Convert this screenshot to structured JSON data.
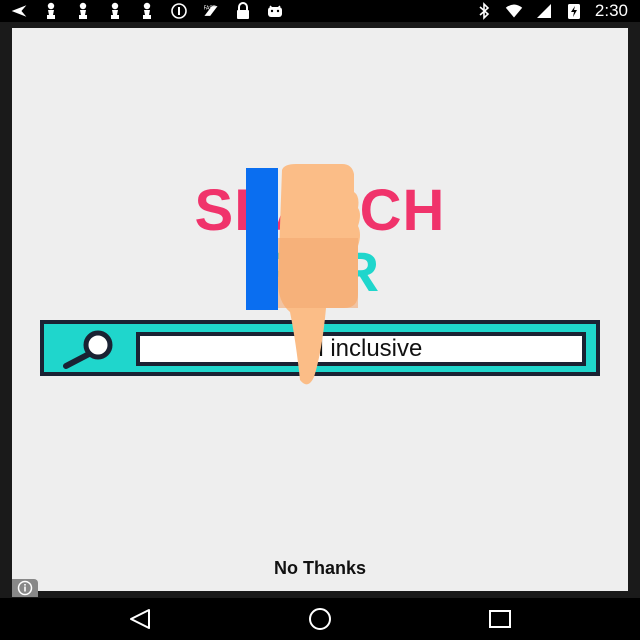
{
  "status_bar": {
    "time": "2:30",
    "left_icons": [
      "back-arrow-icon",
      "chess-pawn-icon",
      "chess-pawn-icon",
      "chess-pawn-icon",
      "chess-pawn-icon",
      "info-circle-icon",
      "fast-icon",
      "lock-icon",
      "android-icon"
    ],
    "right_icons": [
      "bluetooth-icon",
      "wifi-icon",
      "cellular-signal-icon",
      "battery-charging-icon"
    ]
  },
  "ad": {
    "headline_line1": "SEARCH",
    "headline_line2": "FOR",
    "search_query": "all inclusive",
    "dismiss_label": "No Thanks",
    "colors": {
      "headline1": "#f0336b",
      "headline2": "#1fd6cc",
      "search_bar": "#1fd6cc",
      "blue_bar": "#0a6ef0",
      "hand": "#fbbd87"
    }
  },
  "nav_bar": {
    "buttons": [
      "back-icon",
      "home-icon",
      "recents-icon"
    ]
  }
}
